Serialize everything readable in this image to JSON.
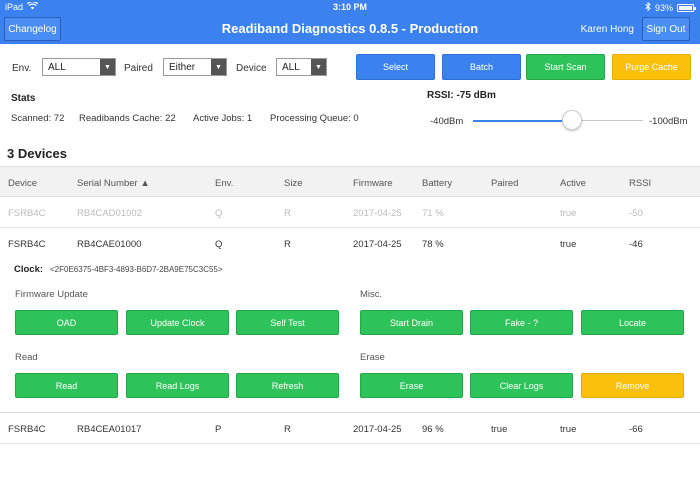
{
  "status_bar": {
    "device": "iPad",
    "time": "3:10 PM",
    "battery": "93%",
    "battery_level": 0.93
  },
  "nav": {
    "changelog_label": "Changelog",
    "title": "Readiband Diagnostics 0.8.5 - Production",
    "user": "Karen Hong",
    "signout_label": "Sign Out"
  },
  "filters": {
    "env_label": "Env.",
    "env_value": "ALL",
    "paired_label": "Paired",
    "paired_value": "Either",
    "device_label": "Device",
    "device_value": "ALL"
  },
  "actions": {
    "select": "Select",
    "batch": "Batch",
    "start_scan": "Start Scan",
    "purge_cache": "Purge Cache"
  },
  "stats": {
    "title": "Stats",
    "scanned": "Scanned: 72",
    "cache": "Readibands Cache: 22",
    "active_jobs": "Active Jobs: 1",
    "queue": "Processing Queue: 0"
  },
  "rssi": {
    "title": "RSSI: -75 dBm",
    "min_label": "-40dBm",
    "max_label": "-100dBm",
    "value": -75,
    "min": -40,
    "max": -100
  },
  "devices": {
    "title": "3 Devices",
    "columns": [
      "Device",
      "Serial Number ▲",
      "Env.",
      "Size",
      "Firmware",
      "Battery",
      "Paired",
      "Active",
      "RSSI"
    ],
    "rows": [
      [
        "FSRB4C",
        "RB4CAD01002",
        "Q",
        "R",
        "2017-04-25",
        "71 %",
        "",
        "true",
        "-50"
      ],
      [
        "FSRB4C",
        "RB4CAE01000",
        "Q",
        "R",
        "2017-04-25",
        "78 %",
        "",
        "true",
        "-46"
      ],
      [
        "FSRB4C",
        "RB4CEA01017",
        "P",
        "R",
        "2017-04-25",
        "96 %",
        "true",
        "true",
        "-66"
      ]
    ]
  },
  "detail": {
    "clock_label": "Clock:",
    "clock_value": "<2F0E6375-4BF3-4893-B6D7-2BA9E75C3C55>",
    "firmware_label": "Firmware Update",
    "misc_label": "Misc.",
    "read_label": "Read",
    "erase_label": "Erase",
    "buttons": {
      "oad": "OAD",
      "update_clock": "Update Clock",
      "self_test": "Self Test",
      "start_drain": "Start Drain",
      "fake": "Fake - ?",
      "locate": "Locate",
      "read": "Read",
      "read_logs": "Read Logs",
      "refresh": "Refresh",
      "erase": "Erase",
      "clear_logs": "Clear Logs",
      "remove": "Remove"
    }
  },
  "colors": {
    "primary_blue": "#3b82f0",
    "green": "#2ec25a",
    "yellow": "#fbc10a"
  }
}
